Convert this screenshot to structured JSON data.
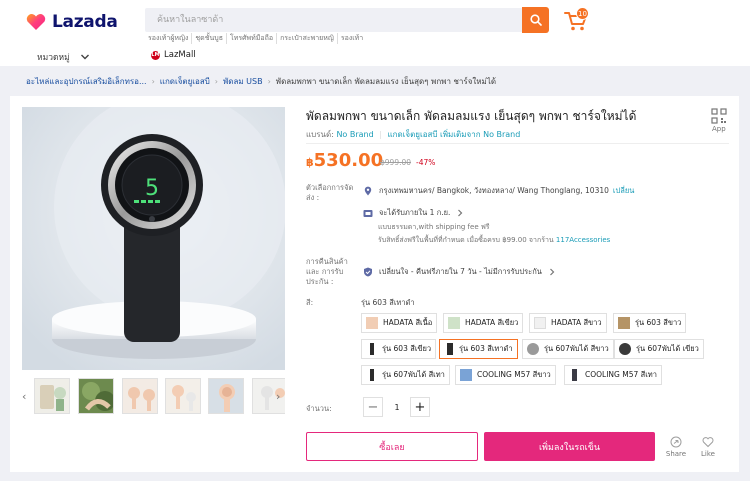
{
  "header": {
    "logo_text": "Lazada",
    "search_placeholder": "ค้นหาในลาซาด้า",
    "cart_count": "10",
    "quick_links": [
      "รองเท้าผู้หญิง",
      "ชุดชั้นบูธ",
      "โทรศัพท์มือถือ",
      "กระเป๋าสะพายหญิ",
      "รองเท้า"
    ],
    "category_label": "หมวดหมู่",
    "lazmall_label": "LazMall",
    "lazmall_badge": "LM"
  },
  "breadcrumb": {
    "items": [
      "อะไหล่และอุปกรณ์เสริมอิเล็กทรอ...",
      "แกดเจ็ตยูเอสบี",
      "พัดลม USB"
    ],
    "current": "พัดลมพกพา ขนาดเล็ก พัดลมลมแรง เย็นสุดๆ พกพา ชาร์จใหม่ได้"
  },
  "product": {
    "title": "พัดลมพกพา ขนาดเล็ก พัดลมลมแรง เย็นสุดๆ พกพา ชาร์จใหม่ได้",
    "brand_label": "แบรนด์:",
    "brand": "No Brand",
    "brand_more": "แกดเจ็ตยูเอสบี เพิ่มเติมจาก No Brand",
    "app_label": "App",
    "currency": "฿",
    "price": "530.00",
    "old_price": "฿999.00",
    "discount": "-47%",
    "fan_display": "5"
  },
  "shipping": {
    "options_label": "ตัวเลือกการจัดส่ง :",
    "location": "กรุงเทพมหานคร/ Bangkok, วังทองหลาง/ Wang Thonglang, 10310",
    "change_label": "เปลี่ยน",
    "delivery": "จะได้รับภายใน 1 ก.ย.",
    "standard_fee": "แบบธรรมดา,with shipping fee ฟรี",
    "free_note": "รับสิทธิ์ส่งฟรีในพื้นที่ที่กำหนด เมื่อซื้อครบ ฿99.00 จากร้าน",
    "free_store": "117Accessories",
    "return_label": "การคืนสินค้าและ การรับประกัน :",
    "return_policy": "เปลี่ยนใจ - คืนฟรีภายใน 7 วัน - ไม่มีการรับประกัน"
  },
  "variants": {
    "color_label": "สี:",
    "selected": "รุ่น 603 สีเทาดำ",
    "options": [
      {
        "label": "HADATA สีเนื้อ",
        "swatch": "#f1cdb4"
      },
      {
        "label": "HADATA สีเขียว",
        "swatch": "#cfe2c8"
      },
      {
        "label": "HADATA สีขาว",
        "swatch": "#f1f1f1"
      },
      {
        "label": "รุ่น 603 สีขาว",
        "swatch": "#b59466"
      },
      {
        "label": "รุ่น 603 สีเขียว",
        "swatch": "#2b2b2b"
      },
      {
        "label": "รุ่น 603 สีเทาดำ",
        "swatch": "#2b2b2b"
      },
      {
        "label": "รุ่น 607พับได้ สีขาว",
        "swatch": "#9a9a9a"
      },
      {
        "label": "รุ่น 607พับได้ เขียว",
        "swatch": "#3a3a3a"
      },
      {
        "label": "รุ่น 607พับได้ สีเทา",
        "swatch": "#2b2b2b"
      },
      {
        "label": "COOLING M57 สีขาว",
        "swatch": "#7aa3d6"
      },
      {
        "label": "COOLING M57 สีเทา",
        "swatch": "#3b3b45"
      }
    ]
  },
  "quantity": {
    "label": "จำนวน:",
    "value": "1",
    "minus": "−",
    "plus": "+"
  },
  "actions": {
    "buy_now": "ซื้อเลย",
    "add_to_cart": "เพิ่มลงในรถเข็น",
    "share": "Share",
    "like": "Like"
  },
  "colors": {
    "accent_orange": "#f57224",
    "brand_pink": "#e4287c",
    "link": "#1a9cb7"
  }
}
